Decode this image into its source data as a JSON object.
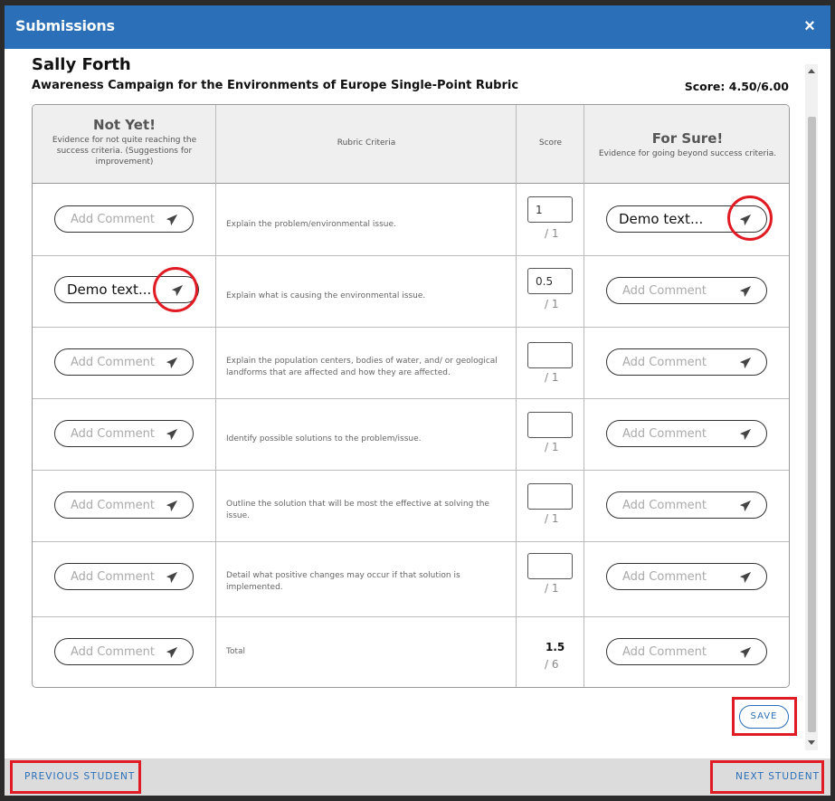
{
  "window": {
    "title": "Submissions",
    "close_label": "×"
  },
  "student": {
    "name": "Sally Forth"
  },
  "rubric": {
    "title": "Awareness Campaign for the Environments of Europe Single-Point Rubric",
    "score_text": "Score: 4.50/6.00"
  },
  "headers": {
    "not_yet_title": "Not Yet!",
    "not_yet_desc": "Evidence for not quite reaching the success criteria. (Suggestions for improvement)",
    "criteria": "Rubric Criteria",
    "score": "Score",
    "for_sure_title": "For Sure!",
    "for_sure_desc": "Evidence for going beyond success criteria."
  },
  "comment_placeholder": "Add Comment",
  "rows": [
    {
      "criteria": "Explain the problem/environmental issue.",
      "score": "1",
      "out_of": "/ 1",
      "not_yet": "",
      "for_sure": "Demo text..."
    },
    {
      "criteria": "Explain what is causing the environmental issue.",
      "score": "0.5",
      "out_of": "/ 1",
      "not_yet": "Demo text...",
      "for_sure": ""
    },
    {
      "criteria": "Explain the population centers, bodies of water, and/ or geological landforms that are affected and how they are affected.",
      "score": "",
      "out_of": "/ 1",
      "not_yet": "",
      "for_sure": ""
    },
    {
      "criteria": "Identify possible solutions to the problem/issue.",
      "score": "",
      "out_of": "/ 1",
      "not_yet": "",
      "for_sure": ""
    },
    {
      "criteria": "Outline the solution that will be most the effective at solving the issue.",
      "score": "",
      "out_of": "/ 1",
      "not_yet": "",
      "for_sure": ""
    },
    {
      "criteria": "Detail what positive changes may occur if that solution is implemented.",
      "score": "",
      "out_of": "/ 1",
      "not_yet": "",
      "for_sure": ""
    }
  ],
  "total": {
    "label": "Total",
    "score": "1.5",
    "out_of": "/ 6"
  },
  "buttons": {
    "save": "SAVE",
    "previous": "PREVIOUS STUDENT",
    "next": "NEXT STUDENT"
  },
  "colors": {
    "accent": "#2a6fb8",
    "highlight": "#e01b24"
  }
}
